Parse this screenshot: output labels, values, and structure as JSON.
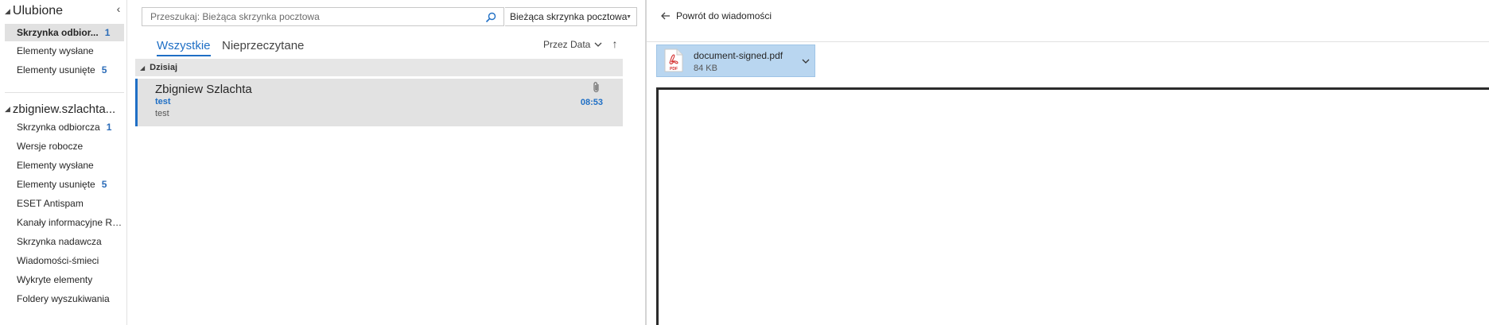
{
  "folders": {
    "favorites_label": "Ulubione",
    "collapse_glyph": "‹",
    "favorites": [
      {
        "label": "Skrzynka odbior...",
        "count": "1",
        "selected": true
      },
      {
        "label": "Elementy wysłane",
        "count": ""
      },
      {
        "label": "Elementy usunięte",
        "count": "5"
      }
    ],
    "account_label": "zbigniew.szlachta...",
    "account_items": [
      {
        "label": "Skrzynka odbiorcza",
        "count": "1"
      },
      {
        "label": "Wersje robocze",
        "count": ""
      },
      {
        "label": "Elementy wysłane",
        "count": ""
      },
      {
        "label": "Elementy usunięte",
        "count": "5"
      },
      {
        "label": "ESET Antispam",
        "count": ""
      },
      {
        "label": "Kanały informacyjne RSS",
        "count": ""
      },
      {
        "label": "Skrzynka nadawcza",
        "count": ""
      },
      {
        "label": "Wiadomości-śmieci",
        "count": ""
      },
      {
        "label": "Wykryte elementy",
        "count": ""
      },
      {
        "label": "Foldery wyszukiwania",
        "count": ""
      }
    ]
  },
  "search": {
    "placeholder": "Przeszukaj: Bieżąca skrzynka pocztowa",
    "scope": "Bieżąca skrzynka pocztowa"
  },
  "list": {
    "tabs": [
      "Wszystkie",
      "Nieprzeczytane"
    ],
    "sort_label": "Przez Data",
    "sort_dir_glyph": "↑",
    "group_label": "Dzisiaj",
    "message": {
      "sender": "Zbigniew Szlachta",
      "subject": "test",
      "preview": "test",
      "time": "08:53"
    }
  },
  "reading": {
    "back_label": "Powrót do wiadomości",
    "attachment": {
      "name": "document-signed.pdf",
      "size": "84 KB",
      "icon_text": "PDF"
    }
  },
  "colors": {
    "accent": "#1f6fc5",
    "selection": "#e1e1e1",
    "attachment_bg": "#b9d6f0",
    "pdf_red": "#d32f2f"
  }
}
